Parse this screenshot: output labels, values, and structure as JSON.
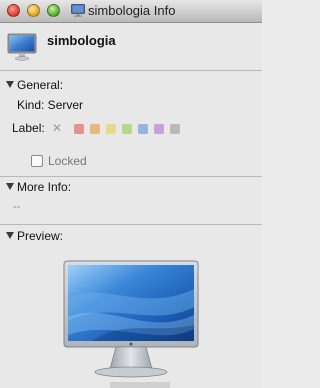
{
  "window": {
    "title": "simbologia Info"
  },
  "header": {
    "name": "simbologia"
  },
  "general": {
    "heading": "General:",
    "kind_text": "Kind: Server",
    "label_text": "Label:",
    "label_clear": "✕",
    "label_colors": [
      "#e05a4c",
      "#e3973a",
      "#e6cf45",
      "#8fcf4f",
      "#5a8fe0",
      "#b071c9",
      "#9a9a9a"
    ],
    "locked_label": "Locked",
    "locked_checked": false
  },
  "more_info": {
    "heading": "More Info:",
    "value": "--"
  },
  "preview": {
    "heading": "Preview:"
  },
  "icons": {
    "title": "display-icon",
    "header": "display-icon",
    "preview": "cinema-display-icon"
  }
}
